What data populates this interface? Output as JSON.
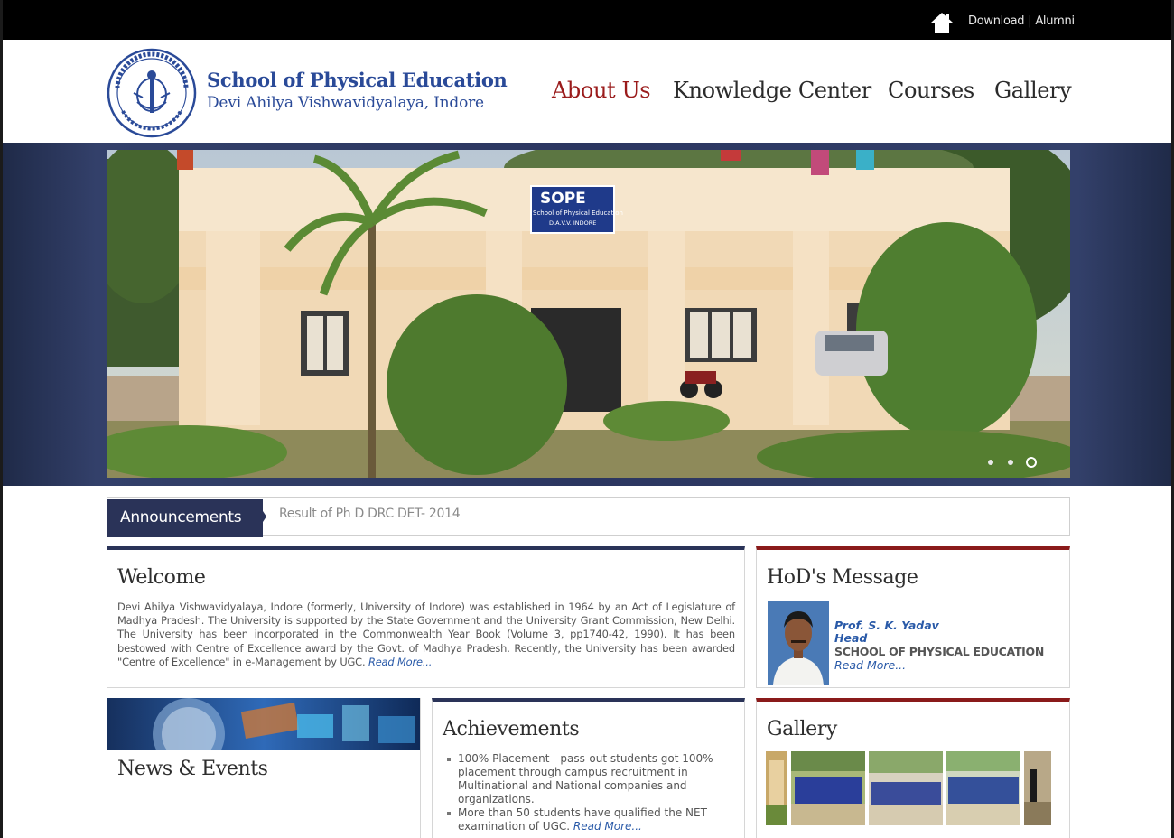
{
  "topbar": {
    "links": [
      "Download",
      "Alumni"
    ],
    "separator": "|",
    "home_icon": "home-icon"
  },
  "header": {
    "title": "School of Physical Education",
    "subtitle": "Devi Ahilya Vishwavidyalaya, Indore",
    "nav": [
      "About Us",
      "Knowledge Center",
      "Courses",
      "Gallery"
    ],
    "active_nav": "About Us",
    "logo_icon": "university-seal-icon"
  },
  "banner": {
    "sign_title": "SOPE",
    "sign_subtitle": "School of Physical Education",
    "sign_line3": "D.A.V.V. INDORE",
    "slides_total": 3,
    "active_slide": 3
  },
  "announcements": {
    "label": "Announcements",
    "item": "Result of Ph D DRC DET- 2014"
  },
  "welcome": {
    "title": "Welcome",
    "text": "Devi Ahilya Vishwavidyalaya, Indore (formerly, University of Indore) was established in 1964 by an Act of Legislature of Madhya Pradesh. The University is supported by the State Government and the University Grant Commission, New Delhi. The University has been incorporated in the Commonwealth Year Book (Volume 3, pp1740-42, 1990). It has been bestowed with  Centre of Excellence award by the Govt. of Madhya Pradesh. Recently, the University has been awarded \"Centre of Excellence\" in e-Management by UGC.",
    "read_more": "Read More..."
  },
  "hod": {
    "title": "HoD's Message",
    "name": "Prof. S. K. Yadav",
    "role": "Head",
    "dept": "SCHOOL OF PHYSICAL EDUCATION",
    "read_more": "Read More..."
  },
  "news": {
    "title": "News & Events"
  },
  "achievements": {
    "title": "Achievements",
    "items": [
      "100% Placement - pass-out students got 100% placement through campus recruitment in Multinational and National companies and organizations.",
      "More than 50 students have qualified the NET examination of UGC."
    ],
    "read_more": "Read More..."
  },
  "gallery": {
    "title": "Gallery"
  },
  "colors": {
    "navy": "#2a3358",
    "maroon": "#8a1a1a",
    "brand_blue": "#2a4a98",
    "active_nav": "#9a1b1b",
    "link_blue": "#2a5aa8"
  }
}
